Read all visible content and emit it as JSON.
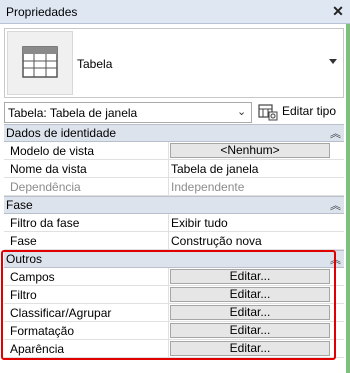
{
  "panel": {
    "title": "Propriedades"
  },
  "type_selector": {
    "name": "Tabela"
  },
  "instance_selector": {
    "value": "Tabela: Tabela de janela",
    "edit_type_label": "Editar tipo"
  },
  "sections": {
    "identity": {
      "title": "Dados de identidade",
      "rows": [
        {
          "label": "Modelo de vista",
          "value": "<Nenhum>"
        },
        {
          "label": "Nome da vista",
          "value": "Tabela de janela"
        },
        {
          "label": "Dependência",
          "value": "Independente"
        }
      ]
    },
    "phase": {
      "title": "Fase",
      "rows": [
        {
          "label": "Filtro da fase",
          "value": "Exibir tudo"
        },
        {
          "label": "Fase",
          "value": "Construção nova"
        }
      ]
    },
    "other": {
      "title": "Outros",
      "rows": [
        {
          "label": "Campos",
          "value": "Editar..."
        },
        {
          "label": "Filtro",
          "value": "Editar..."
        },
        {
          "label": "Classificar/Agrupar",
          "value": "Editar..."
        },
        {
          "label": "Formatação",
          "value": "Editar..."
        },
        {
          "label": "Aparência",
          "value": "Editar..."
        }
      ]
    }
  },
  "icons": {
    "close": "close-icon",
    "table": "table-icon",
    "edit_type": "edit-type-icon",
    "collapse": "collapse-icon"
  },
  "colors": {
    "highlight": "#e00000",
    "section_header": "#dde3ec",
    "titlebar": "#dfe7f3"
  }
}
